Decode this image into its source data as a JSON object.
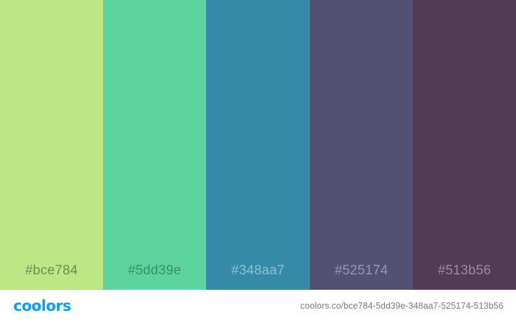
{
  "swatches": [
    {
      "hex": "#bce784",
      "label": "#bce784",
      "label_color": "#6d8a55"
    },
    {
      "hex": "#5dd39e",
      "label": "#5dd39e",
      "label_color": "#3f8c69"
    },
    {
      "hex": "#348aa7",
      "label": "#348aa7",
      "label_color": "#8fc1d4"
    },
    {
      "hex": "#525174",
      "label": "#525174",
      "label_color": "#9796b6"
    },
    {
      "hex": "#513b56",
      "label": "#513b56",
      "label_color": "#9d8aa3"
    }
  ],
  "footer": {
    "logo_text": "coolors",
    "logo_color": "#0a9cf0",
    "url": "coolors.co/bce784-5dd39e-348aa7-525174-513b56"
  }
}
